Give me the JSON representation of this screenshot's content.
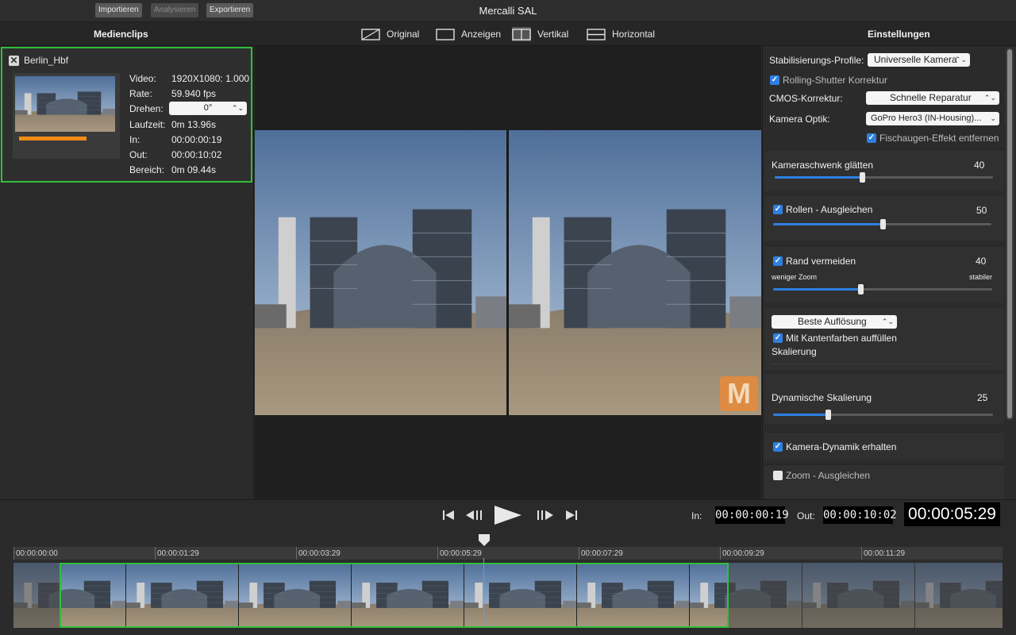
{
  "toolbar": {
    "import_label": "Importieren",
    "analyze_label": "Analysieren",
    "export_label": "Exportieren",
    "app_title": "Mercalli SAL"
  },
  "header": {
    "left_title": "Medienclips",
    "right_title": "Einstellungen",
    "view_modes": [
      {
        "label": "Original",
        "icon": "original-view-icon"
      },
      {
        "label": "Anzeigen",
        "icon": "display-view-icon"
      },
      {
        "label": "Vertikal",
        "icon": "vertical-split-icon",
        "active": true
      },
      {
        "label": "Horizontal",
        "icon": "horizontal-split-icon"
      }
    ]
  },
  "clip": {
    "name": "Berlin_Hbf",
    "checked": true,
    "progress_fraction": 0.68,
    "meta": [
      {
        "label": "Video:",
        "value": "1920X1080: 1.000"
      },
      {
        "label": "Rate:",
        "value": "59.940 fps"
      },
      {
        "label": "Drehen:",
        "value": "0°"
      },
      {
        "label": "Laufzeit:",
        "value": "0m 13.96s"
      },
      {
        "label": "In:",
        "value": "00:00:00:19"
      },
      {
        "label": "Out:",
        "value": "00:00:10:02"
      },
      {
        "label": "Bereich:",
        "value": "0m 09.44s"
      }
    ]
  },
  "settings": {
    "profile_label": "Stabilisierungs-Profile:",
    "profile_value": "Universelle Kamera",
    "rolling_shutter_label": "Rolling-Shutter Korrektur",
    "cmos_label": "CMOS-Korrektur:",
    "cmos_value": "Schnelle Reparatur",
    "optics_label": "Kamera Optik:",
    "optics_value": "GoPro Hero3 (IN-Housing)...",
    "fisheye_label": "Fischaugen-Effekt entfernen",
    "pan_label": "Kameraschwenk glätten",
    "pan_value": "40",
    "pan_fraction": 0.4,
    "roll_label": "Rollen - Ausgleichen",
    "roll_value": "50",
    "roll_fraction": 0.5,
    "border_label": "Rand vermeiden",
    "border_value": "40",
    "border_fraction": 0.4,
    "border_min_label": "weniger Zoom",
    "border_max_label": "stabiler",
    "resolution_value": "Beste Auflösung",
    "edgefill_label": "Mit Kantenfarben auffüllen",
    "scaling_label": "Skalierung",
    "dyn_scaling_label": "Dynamische Skalierung",
    "dyn_scaling_value": "25",
    "dyn_scaling_fraction": 0.25,
    "keep_dynamics_label": "Kamera-Dynamik erhalten",
    "zoom_label": "Zoom - Ausgleichen"
  },
  "transport": {
    "in_label": "In:",
    "in_value": "00:00:00:19",
    "out_label": "Out:",
    "out_value": "00:00:10:02",
    "current_time": "00:00:05:29"
  },
  "timeline": {
    "ticks": [
      "00:00:00:00",
      "00:00:01:29",
      "00:00:03:29",
      "00:00:05:29",
      "00:00:07:29",
      "00:00:09:29",
      "00:00:11:29"
    ]
  },
  "colors": {
    "selection_green": "#2fbf3a",
    "accent_blue": "#2f7fe0",
    "progress_orange": "#f08c16"
  }
}
